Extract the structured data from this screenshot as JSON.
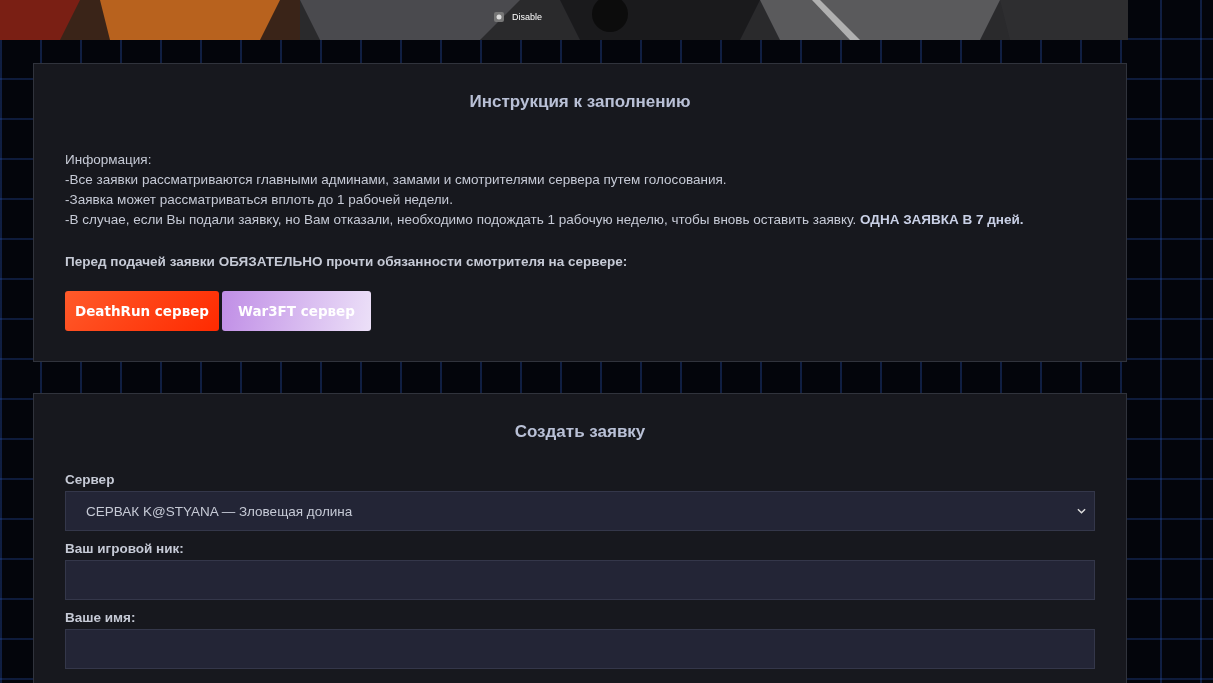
{
  "banner": {
    "overlay_label": "Disable"
  },
  "instructions": {
    "title": "Инструкция к заполнению",
    "lines": [
      "Информация:",
      "-Все заявки рассматриваются главными админами, замами и смотрителями сервера путем голосования.",
      "-Заявка может рассматриваться вплоть до 1 рабочей недели.",
      "-В случае, если Вы подали заявку, но Вам отказали, необходимо подождать 1 рабочую неделю, чтобы вновь оставить заявку. **ОДНА ЗАЯВКА В 7 дней.**"
    ],
    "notice": "Перед подачей заявки ОБЯЗАТЕЛЬНО прочти обязанности смотрителя на сервере:",
    "buttons": [
      {
        "label": "DeathRun сервер",
        "kind": "deathrun"
      },
      {
        "label": "War3FT сервер",
        "kind": "war3ft"
      }
    ]
  },
  "form": {
    "title": "Создать заявку",
    "fields": [
      {
        "label": "Сервер",
        "kind": "select",
        "value": "СЕРВАК K@STYANA — Зловещая долина"
      },
      {
        "label": "Ваш игровой ник:",
        "kind": "text"
      },
      {
        "label": "Ваше имя:",
        "kind": "text"
      }
    ]
  }
}
